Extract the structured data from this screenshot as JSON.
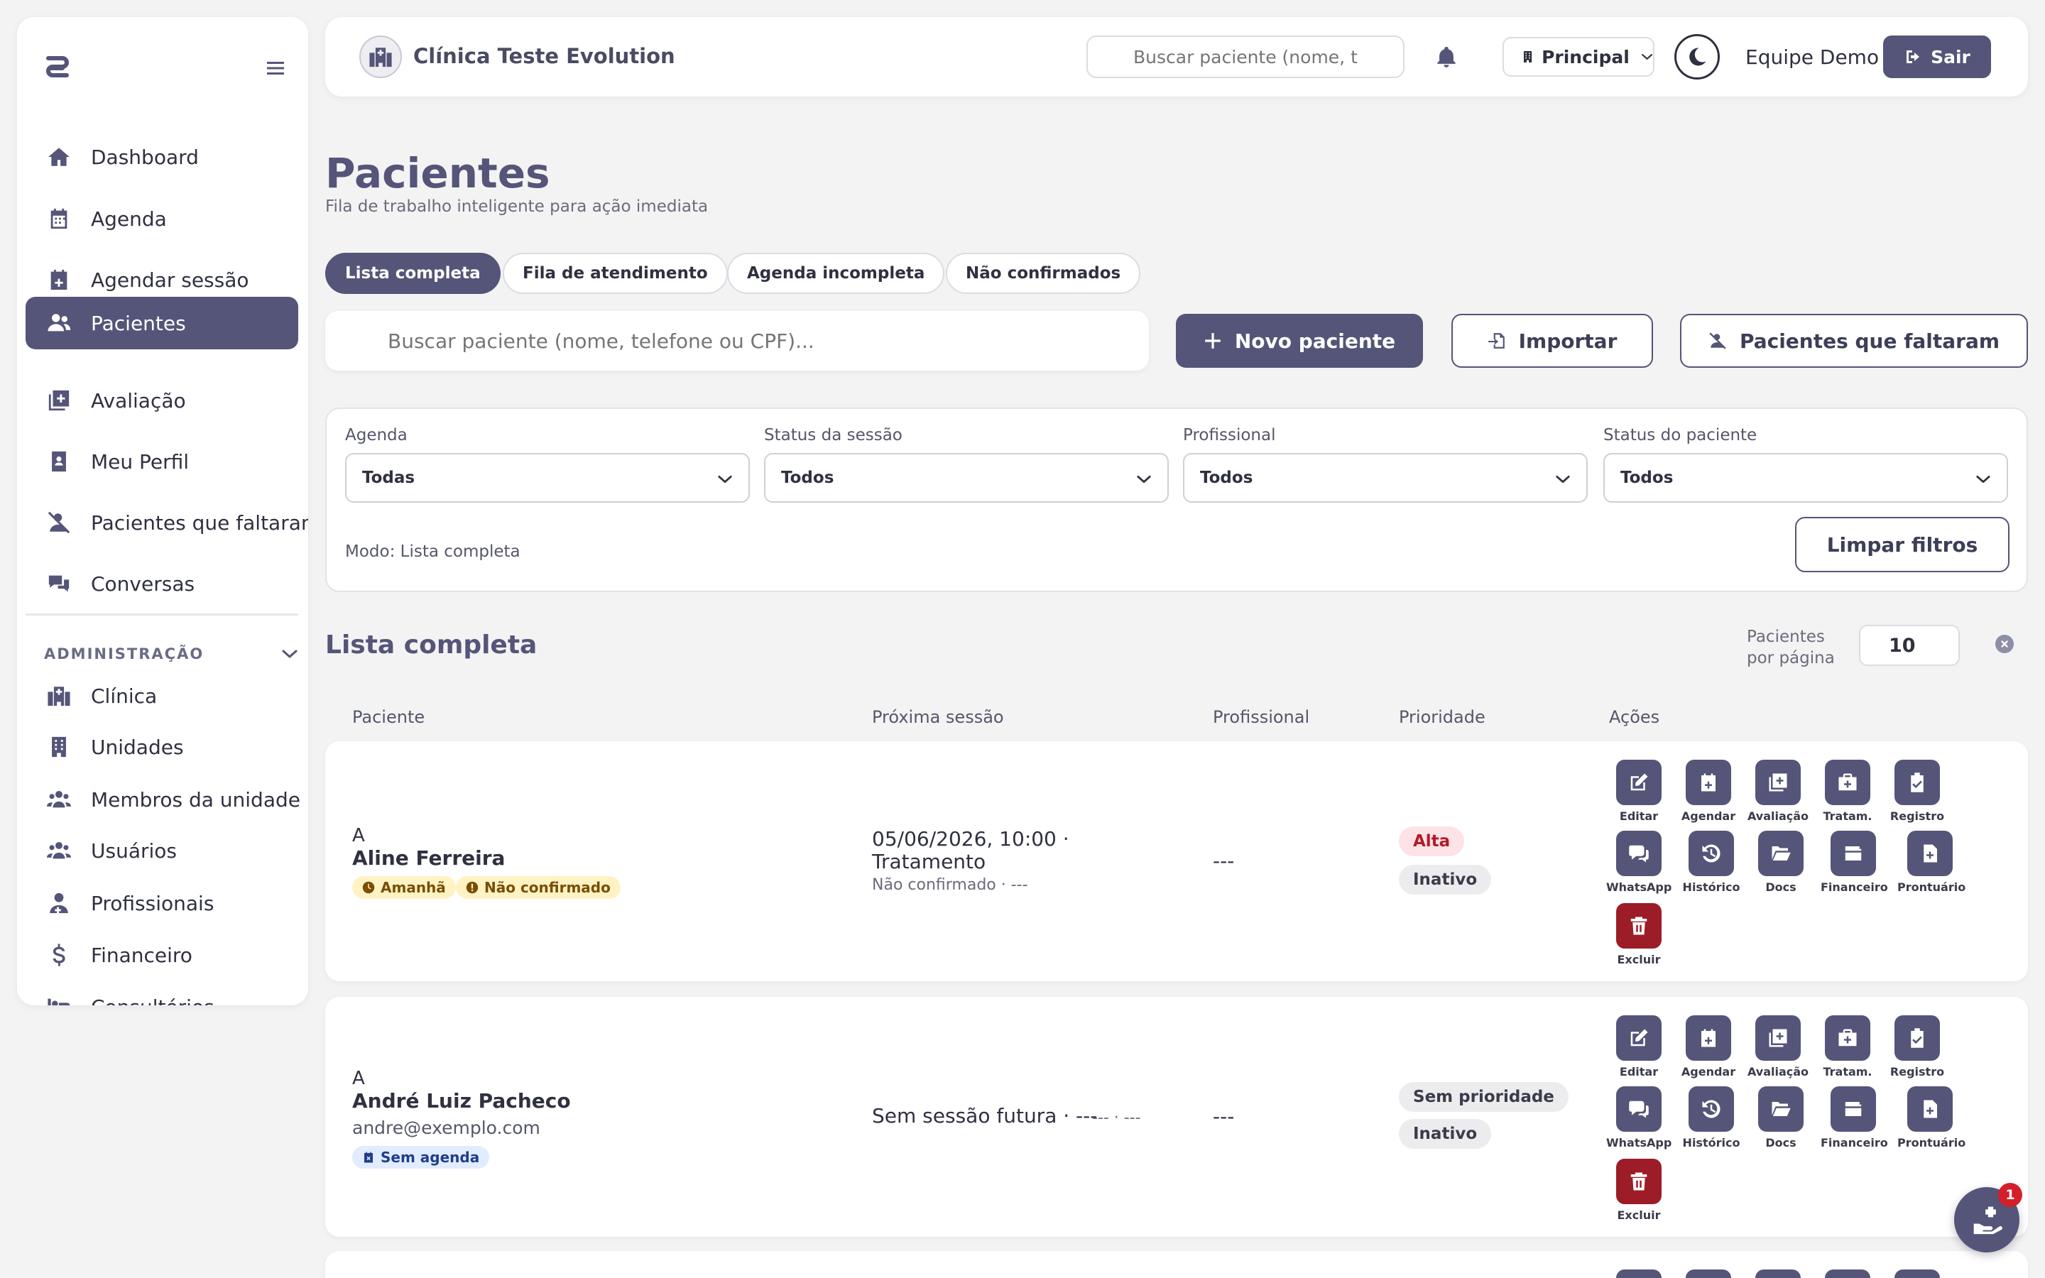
{
  "sidebar": {
    "items": [
      {
        "label": "Dashboard",
        "icon": "home-icon"
      },
      {
        "label": "Agenda",
        "icon": "calendar-icon"
      },
      {
        "label": "Agendar sessão",
        "icon": "calendar-plus-icon"
      },
      {
        "label": "Pacientes",
        "icon": "users-icon",
        "active": true
      },
      {
        "label": "Avaliação",
        "icon": "plus-square-icon"
      },
      {
        "label": "Meu Perfil",
        "icon": "id-badge-icon"
      },
      {
        "label": "Pacientes que faltaram",
        "icon": "user-slash-icon"
      },
      {
        "label": "Conversas",
        "icon": "chat-icon"
      }
    ],
    "admin_title": "ADMINISTRAÇÃO",
    "admin_items": [
      {
        "label": "Clínica",
        "icon": "hospital-icon"
      },
      {
        "label": "Unidades",
        "icon": "building-icon"
      },
      {
        "label": "Membros da unidade",
        "icon": "users-group-icon"
      },
      {
        "label": "Usuários",
        "icon": "users-group-icon"
      },
      {
        "label": "Profissionais",
        "icon": "user-doctor-icon"
      },
      {
        "label": "Financeiro",
        "icon": "dollar-icon"
      },
      {
        "label": "Consultórios",
        "icon": "bed-icon"
      }
    ]
  },
  "header": {
    "clinic_name": "Clínica Teste Evolution",
    "search_placeholder": "Buscar paciente (nome, t",
    "unit": "Principal",
    "user": "Equipe Demo",
    "logout": "Sair"
  },
  "page": {
    "title": "Pacientes",
    "subtitle": "Fila de trabalho inteligente para ação imediata"
  },
  "tabs": [
    "Lista completa",
    "Fila de atendimento",
    "Agenda incompleta",
    "Não confirmados"
  ],
  "search": {
    "placeholder": "Buscar paciente (nome, telefone ou CPF)..."
  },
  "actions": {
    "new_patient": "Novo paciente",
    "import": "Importar",
    "missed": "Pacientes que faltaram"
  },
  "filters": {
    "agenda": {
      "label": "Agenda",
      "value": "Todas"
    },
    "session_status": {
      "label": "Status da sessão",
      "value": "Todos"
    },
    "professional": {
      "label": "Profissional",
      "value": "Todos"
    },
    "patient_status": {
      "label": "Status do paciente",
      "value": "Todos"
    },
    "mode": "Modo: Lista completa",
    "clear": "Limpar filtros"
  },
  "list": {
    "title": "Lista completa",
    "per_page_label_1": "Pacientes",
    "per_page_label_2": "por página",
    "per_page": "10",
    "columns": [
      "Paciente",
      "Próxima sessão",
      "Profissional",
      "Prioridade",
      "Ações"
    ],
    "action_labels": [
      "Editar",
      "Agendar",
      "Avaliação",
      "Tratam.",
      "Registro",
      "WhatsApp",
      "Histórico",
      "Docs",
      "Financeiro",
      "Prontuário",
      "Excluir"
    ],
    "rows": [
      {
        "initial": "A",
        "name": "Aline Ferreira",
        "chips": [
          "Amanhã",
          "Não confirmado"
        ],
        "session_line1": "05/06/2026, 10:00 ·",
        "session_line2": "Tratamento",
        "session_sub": "Não confirmado · ---",
        "professional": "---",
        "priority": "Alta",
        "status": "Inativo"
      },
      {
        "initial": "A",
        "name": "André Luiz Pacheco",
        "email": "andre@exemplo.com",
        "chip": "Sem agenda",
        "session_line1": "Sem sessão futura · ---",
        "session_sub": "--- · ---",
        "professional": "---",
        "priority": "Sem prioridade",
        "status": "Inativo"
      }
    ]
  },
  "notification_badge": "1",
  "colors": {
    "primary": "#545578",
    "danger": "#9c1c28",
    "background": "#f3f3f4"
  }
}
